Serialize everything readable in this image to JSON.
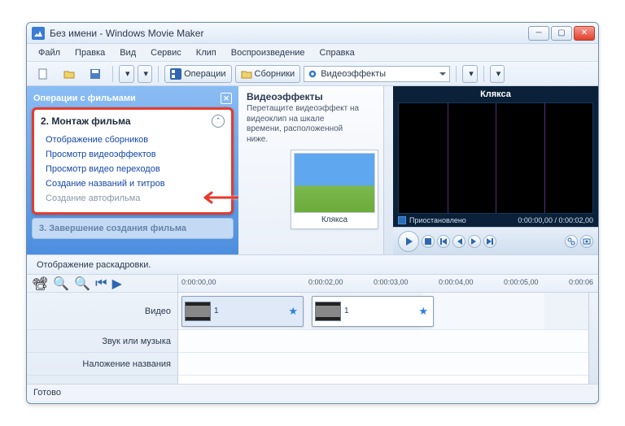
{
  "window_title": "Без имени - Windows Movie Maker",
  "menu": [
    "Файл",
    "Правка",
    "Вид",
    "Сервис",
    "Клип",
    "Воспроизведение",
    "Справка"
  ],
  "toolbar": {
    "operations": "Операции",
    "collections": "Сборники",
    "dropdown": "Видеоэффекты"
  },
  "tasks": {
    "panel_title": "Операции с фильмами",
    "section2": {
      "title": "2. Монтаж фильма",
      "items": [
        "Отображение сборников",
        "Просмотр видеоэффектов",
        "Просмотр видео переходов",
        "Создание названий и титров",
        "Создание автофильма"
      ]
    },
    "section3_title": "3. Завершение создания фильма"
  },
  "gallery": {
    "title": "Видеоэффекты",
    "subtitle": "Перетащите видеоэффект на видеоклип на шкале времени, расположенной ниже.",
    "clip_label": "Клякса"
  },
  "preview": {
    "title": "Клякса",
    "status": "Приостановлено",
    "time": "0:00:00,00 / 0:00:02,00"
  },
  "timeline": {
    "mode_label": "Отображение раскадровки.",
    "ticks": [
      "0:00:00,00",
      "",
      "0:00:02,00",
      "0:00:03,00",
      "0:00:04,00",
      "0:00:05,00",
      "0:00:06"
    ],
    "rows": {
      "video": "Видео",
      "audio": "Звук или музыка",
      "title": "Наложение названия"
    },
    "clips": [
      {
        "num": "1"
      },
      {
        "num": "1"
      }
    ]
  },
  "status_bar": "Готово"
}
